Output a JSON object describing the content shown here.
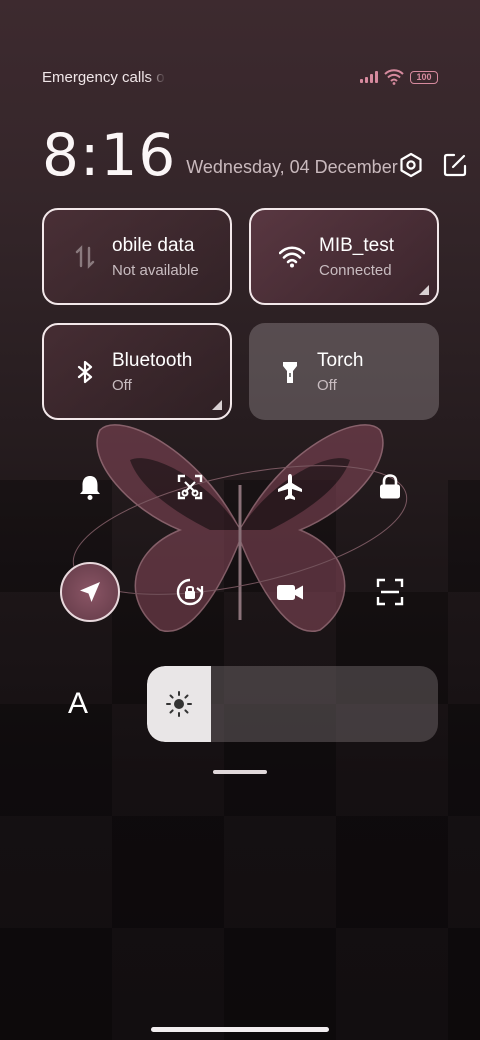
{
  "status_bar": {
    "carrier_text": "Emergency calls o",
    "battery_level": "100",
    "signal_strength_bars": 4,
    "wifi_connected": true,
    "accent_color": "#d68a9e"
  },
  "header": {
    "time": "8:16",
    "date": "Wednesday, 04 December",
    "icons": [
      "settings-icon",
      "edit-icon"
    ]
  },
  "tiles": {
    "mobile_data": {
      "title": "obile data",
      "status": "Not available",
      "icon": "mobile-data-icon"
    },
    "wifi": {
      "title": "MIB_test",
      "status": "Connected",
      "icon": "wifi-icon"
    },
    "bluetooth": {
      "title": "Bluetooth",
      "status": "Off",
      "icon": "bluetooth-icon"
    },
    "torch": {
      "title": "Torch",
      "status": "Off",
      "icon": "torch-icon"
    }
  },
  "toggles_row1": [
    "bell-icon",
    "screenshot-icon",
    "airplane-icon",
    "lock-icon"
  ],
  "toggles_row2": [
    "location-icon",
    "rotation-lock-icon",
    "video-camera-icon",
    "scan-icon"
  ],
  "brightness": {
    "auto_label": "A",
    "level_fraction": 0.22
  }
}
